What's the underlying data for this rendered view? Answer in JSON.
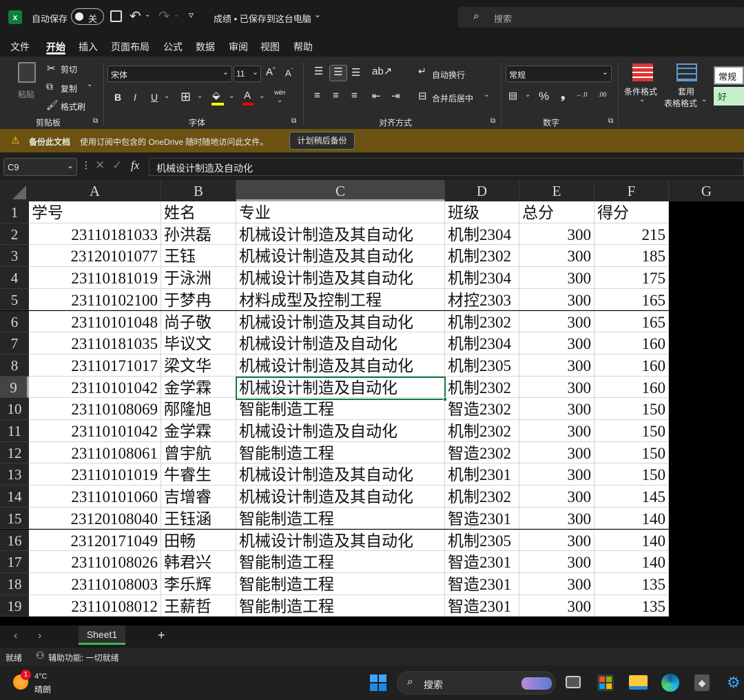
{
  "titlebar": {
    "autosave_label": "自动保存",
    "autosave_state": "关",
    "doc_title": "成绩 • 已保存到这台电脑",
    "search_placeholder": "搜索"
  },
  "tabs": [
    "文件",
    "开始",
    "插入",
    "页面布局",
    "公式",
    "数据",
    "审阅",
    "视图",
    "帮助"
  ],
  "active_tab": "开始",
  "ribbon": {
    "paste": "粘贴",
    "cut": "剪切",
    "copy": "复制",
    "format_painter": "格式刷",
    "clipboard_group": "剪贴板",
    "font_name": "宋体",
    "font_size": "11",
    "font_group": "字体",
    "wrap_text": "自动换行",
    "merge_center": "合并后居中",
    "align_group": "对齐方式",
    "number_format": "常规",
    "number_group": "数字",
    "cond_format": "条件格式",
    "table_format_1": "套用",
    "table_format_2": "表格格式",
    "style_normal": "常规",
    "style_good": "好",
    "bold": "B",
    "italic": "I",
    "underline": "U",
    "font_color_a": "A",
    "wen": "wén",
    "percent": "%",
    "inc_dec_1": "←.0",
    "inc_dec_2": ".00"
  },
  "warning": {
    "title": "备份此文档",
    "message": "使用订阅中包含的 OneDrive 随时随地访问此文件。",
    "button": "计划稍后备份"
  },
  "formula_bar": {
    "name_box": "C9",
    "fx": "fx",
    "content": "机械设计制造及自动化"
  },
  "columns": [
    "A",
    "B",
    "C",
    "D",
    "E",
    "F",
    "G"
  ],
  "rows": [
    {
      "n": "1",
      "a": "学号",
      "b": "姓名",
      "c": "专业",
      "d": "班级",
      "e": "总分",
      "f": "得分"
    },
    {
      "n": "2",
      "a": "23110181033",
      "b": "孙洪磊",
      "c": "机械设计制造及其自动化",
      "d": "机制2304",
      "e": "300",
      "f": "215"
    },
    {
      "n": "3",
      "a": "23120101077",
      "b": "王钰",
      "c": "机械设计制造及其自动化",
      "d": "机制2302",
      "e": "300",
      "f": "185"
    },
    {
      "n": "4",
      "a": "23110181019",
      "b": "于泳洲",
      "c": "机械设计制造及其自动化",
      "d": "机制2304",
      "e": "300",
      "f": "175"
    },
    {
      "n": "5",
      "a": "23110102100",
      "b": "于梦冉",
      "c": "材料成型及控制工程",
      "d": "材控2303",
      "e": "300",
      "f": "165"
    },
    {
      "n": "6",
      "a": "23110101048",
      "b": "尚子敬",
      "c": "机械设计制造及其自动化",
      "d": "机制2302",
      "e": "300",
      "f": "165"
    },
    {
      "n": "7",
      "a": "23110181035",
      "b": "毕议文",
      "c": "机械设计制造及自动化",
      "d": "机制2304",
      "e": "300",
      "f": "160"
    },
    {
      "n": "8",
      "a": "23110171017",
      "b": "梁文华",
      "c": "机械设计制造及其自动化",
      "d": "机制2305",
      "e": "300",
      "f": "160"
    },
    {
      "n": "9",
      "a": "23110101042",
      "b": "金学霖",
      "c": "机械设计制造及自动化",
      "d": "机制2302",
      "e": "300",
      "f": "160"
    },
    {
      "n": "10",
      "a": "23110108069",
      "b": "邴隆旭",
      "c": "智能制造工程",
      "d": "智造2302",
      "e": "300",
      "f": "150"
    },
    {
      "n": "11",
      "a": "23110101042",
      "b": "金学霖",
      "c": "机械设计制造及自动化",
      "d": "机制2302",
      "e": "300",
      "f": "150"
    },
    {
      "n": "12",
      "a": "23110108061",
      "b": "曾宇航",
      "c": "智能制造工程",
      "d": "智造2302",
      "e": "300",
      "f": "150"
    },
    {
      "n": "13",
      "a": "23110101019",
      "b": "牛睿生",
      "c": "机械设计制造及其自动化",
      "d": "机制2301",
      "e": "300",
      "f": "150"
    },
    {
      "n": "14",
      "a": "23110101060",
      "b": "吉增睿",
      "c": "机械设计制造及其自动化",
      "d": "机制2302",
      "e": "300",
      "f": "145"
    },
    {
      "n": "15",
      "a": "23120108040",
      "b": "王钰涵",
      "c": "智能制造工程",
      "d": "智造2301",
      "e": "300",
      "f": "140"
    },
    {
      "n": "16",
      "a": "23120171049",
      "b": "田畅",
      "c": "机械设计制造及其自动化",
      "d": "机制2305",
      "e": "300",
      "f": "140"
    },
    {
      "n": "17",
      "a": "23110108026",
      "b": "韩君兴",
      "c": "智能制造工程",
      "d": "智造2301",
      "e": "300",
      "f": "140"
    },
    {
      "n": "18",
      "a": "23110108003",
      "b": "李乐辉",
      "c": "智能制造工程",
      "d": "智造2301",
      "e": "300",
      "f": "135"
    },
    {
      "n": "19",
      "a": "23110108012",
      "b": "王薪哲",
      "c": "智能制造工程",
      "d": "智造2301",
      "e": "300",
      "f": "135"
    }
  ],
  "sheet_tab": "Sheet1",
  "status": {
    "ready": "就绪",
    "accessibility": "辅助功能: 一切就绪"
  },
  "taskbar": {
    "weather_temp": "4°C",
    "weather_desc": "晴朗",
    "badge": "1",
    "search": "搜索"
  },
  "colors": {
    "accent_green": "#107c41",
    "warning_bg": "#6b5211",
    "style_good_bg": "#c6efce"
  }
}
